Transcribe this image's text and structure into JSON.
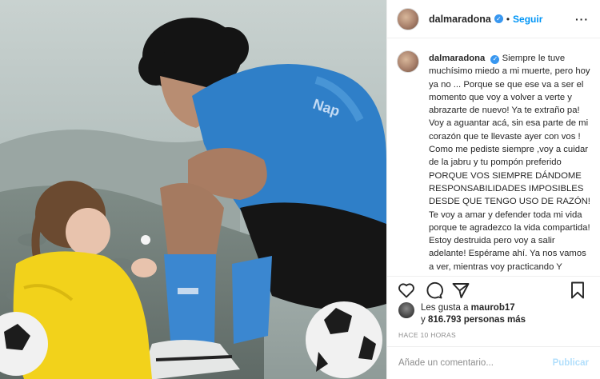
{
  "post": {
    "username": "dalmaradona",
    "follow_label": "Seguir",
    "separator": "•",
    "more_label": "···",
    "verified_icon": "verified-badge-icon",
    "caption_text": "Siempre le tuve muchísimo miedo a mi muerte, pero hoy ya no ... Porque se que ese va a ser el momento que voy a volver a verte y abrazarte de nuevo! Ya te extraño pa! Voy a aguantar acá, sin esa parte de mi corazón que te llevaste ayer con vos ! Como me pediste siempre ,voy a cuidar de la jabru y tu pompón preferido PORQUE VOS SIEMPRE DÁNDOME RESPONSABILIDADES IMPOSIBLES DESDE QUE TENGO USO DE RAZÓN! Te voy a amar y defender toda mi vida porque te agradezco la vida compartida! Estoy destruida pero voy a salir adelante! Espérame ahí. Ya nos vamos a ver, mientras voy practicando Y COMO ES EL...",
    "likes_prefix": "Les gusta a",
    "likes_user": "maurob17",
    "likes_and": "y",
    "likes_count": "816.793 personas más",
    "time": "HACE 10 HORAS",
    "comment_placeholder": "Añade un comentario...",
    "publish_label": "Publicar",
    "icons": [
      "heart-icon",
      "comment-icon",
      "share-icon",
      "bookmark-icon"
    ]
  },
  "colors": {
    "accent": "#0095f6",
    "verified": "#3897f0",
    "publish_disabled": "#b2dffc",
    "jersey": "#2f7fc8",
    "raincoat": "#f2d21b"
  }
}
